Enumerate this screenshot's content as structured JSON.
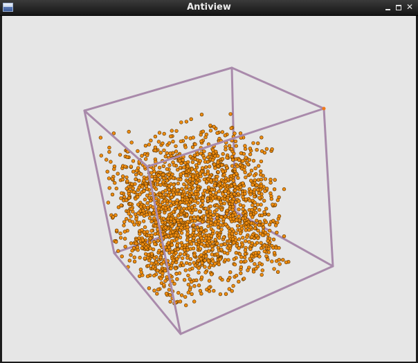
{
  "window": {
    "title": "Antiview",
    "app_icon": "window-app-icon",
    "controls": {
      "minimize_icon": "minimize-icon",
      "maximize_icon": "maximize-icon",
      "close_glyph": "✕"
    }
  },
  "scene": {
    "background_color": "#e6e6e6",
    "bounding_box_color": "#a98aab",
    "particle_fill_color": "#ee8c10",
    "particle_outline_color": "#5a3300",
    "highlight_vertex_color": "#f07a1a"
  }
}
